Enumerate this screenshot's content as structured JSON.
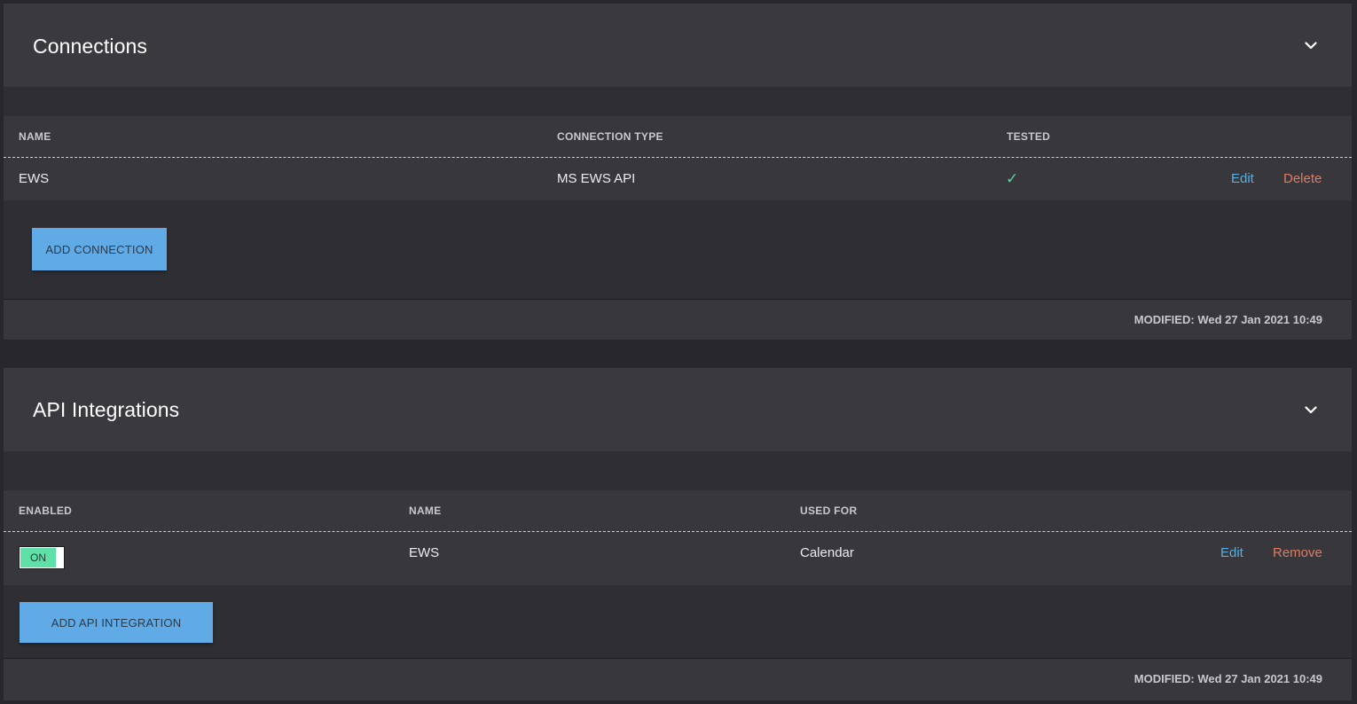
{
  "connections": {
    "title": "Connections",
    "columns": {
      "name": "NAME",
      "connection_type": "CONNECTION TYPE",
      "tested": "TESTED"
    },
    "rows": [
      {
        "name": "EWS",
        "connection_type": "MS EWS API",
        "tested": "✓",
        "edit": "Edit",
        "delete": "Delete"
      }
    ],
    "add_button": "ADD CONNECTION",
    "modified_label": "MODIFIED:",
    "modified_value": "Wed 27 Jan 2021 10:49"
  },
  "api_integrations": {
    "title": "API Integrations",
    "columns": {
      "enabled": "ENABLED",
      "name": "NAME",
      "used_for": "USED FOR"
    },
    "rows": [
      {
        "enabled": "ON",
        "name": "EWS",
        "used_for": "Calendar",
        "edit": "Edit",
        "remove": "Remove"
      }
    ],
    "add_button": "ADD API INTEGRATION",
    "modified_label": "MODIFIED:",
    "modified_value": "Wed 27 Jan 2021 10:49"
  },
  "icons": {
    "collapse": "chevron-down-icon",
    "tested": "checkmark-icon"
  },
  "colors": {
    "edit_link": "#5aaede",
    "delete_link": "#e07a63",
    "button": "#60aae6",
    "toggle_on": "#5fe0a8",
    "check": "#55d3a0"
  }
}
